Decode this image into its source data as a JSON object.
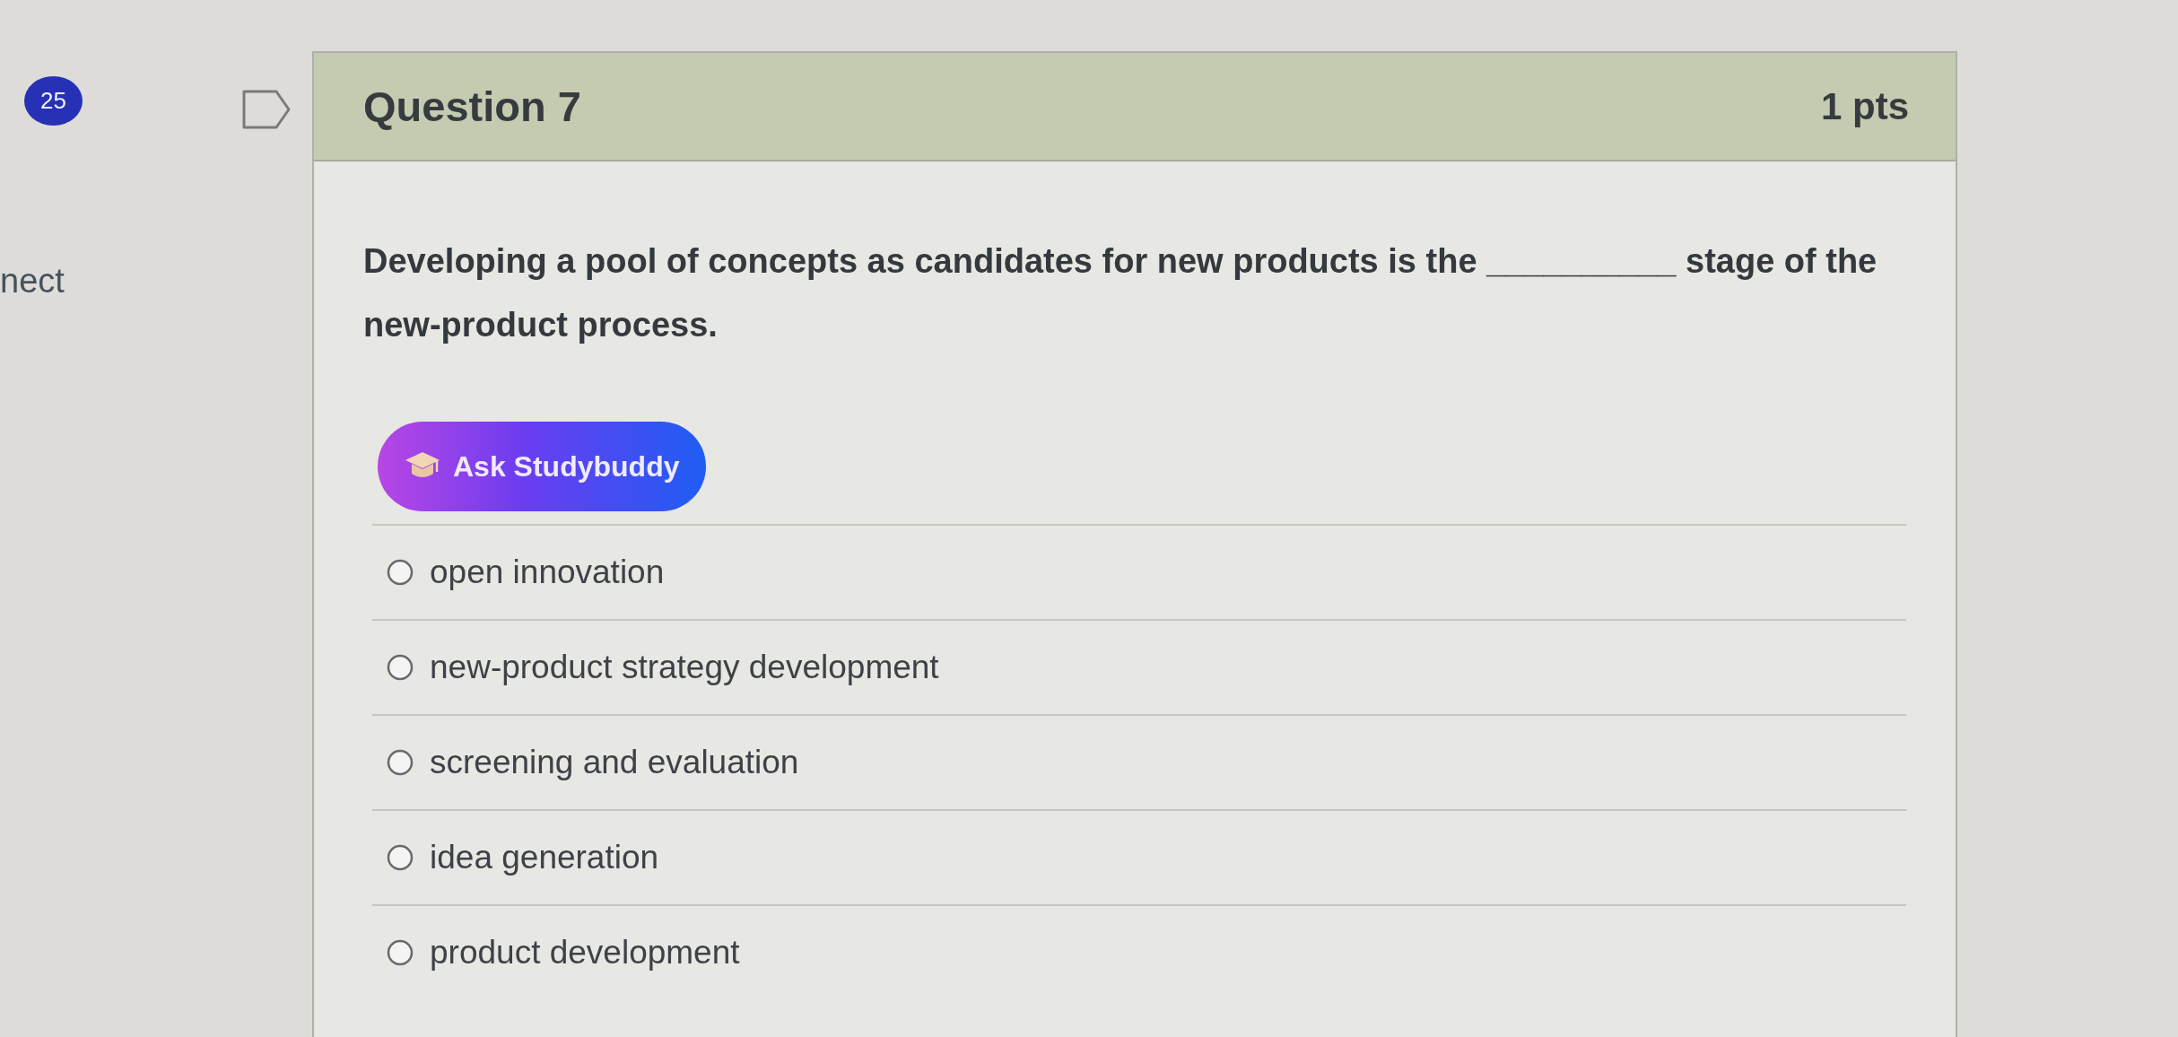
{
  "sidebar": {
    "badge": "25",
    "label": "nect"
  },
  "question": {
    "flagged": false,
    "title": "Question 7",
    "points": "1 pts",
    "text": "Developing a pool of concepts as candidates for new products is the __________ stage of the new-product process."
  },
  "assistant_button": {
    "label": "Ask Studybuddy"
  },
  "answers": [
    {
      "label": "open innovation",
      "selected": false
    },
    {
      "label": "new-product strategy development",
      "selected": false
    },
    {
      "label": "screening and evaluation",
      "selected": false
    },
    {
      "label": "idea generation",
      "selected": false
    },
    {
      "label": "product development",
      "selected": false
    }
  ]
}
